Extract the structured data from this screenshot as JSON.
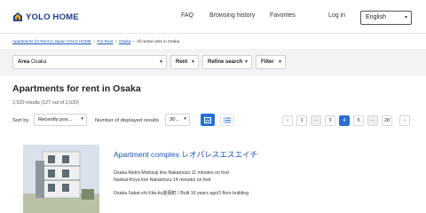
{
  "header": {
    "brand": "YOLO HOME",
    "nav": [
      "FAQ",
      "Browsing history",
      "Favorites",
      "Log in"
    ],
    "language": "English"
  },
  "breadcrumb": {
    "items": [
      "Apartments for Rent in Japan YOLO HOME",
      "For Rent",
      "Osaka"
    ],
    "current": "All rental units in Osaka"
  },
  "filters": {
    "area_label": "Area",
    "area_value": "Osaka",
    "rent": "Rent",
    "refine": "Refine search",
    "filter": "Filter"
  },
  "results": {
    "title": "Apartments for rent in Osaka",
    "count": "2,520 results (127 out of 2,520)"
  },
  "controls": {
    "sort_label": "Sort by",
    "sort_value": "Recently pos...",
    "display_label": "Number of displayed results",
    "display_value": "30..."
  },
  "pagination": {
    "prev": "‹",
    "first": "1",
    "ellipsis": "···",
    "pages": [
      "3",
      "4",
      "5"
    ],
    "current": "4",
    "last": "28",
    "next": "›"
  },
  "listing": {
    "title": "Apartment complex レオパレスエスエイチ",
    "access_1": "Osaka Metro-Midosuji line Nakamozu 11 minutes on foot",
    "access_2": "Nankai-Koya line Nakamozu 14 minutes on foot",
    "address": "Osaka Sakai-shi Kita-ku金岡町 / Built 16 years ago/3 floor building"
  },
  "icons": {
    "logo": "yolo-home-logo-icon",
    "grid_view": "grid-view-icon",
    "list_view": "list-view-icon",
    "chevron": "chevron-down-icon"
  },
  "colors": {
    "brand": "#1a3e8a",
    "accent": "#2a6fd6",
    "link": "#1a55b0",
    "filter_bar": "#f2f3f5"
  }
}
